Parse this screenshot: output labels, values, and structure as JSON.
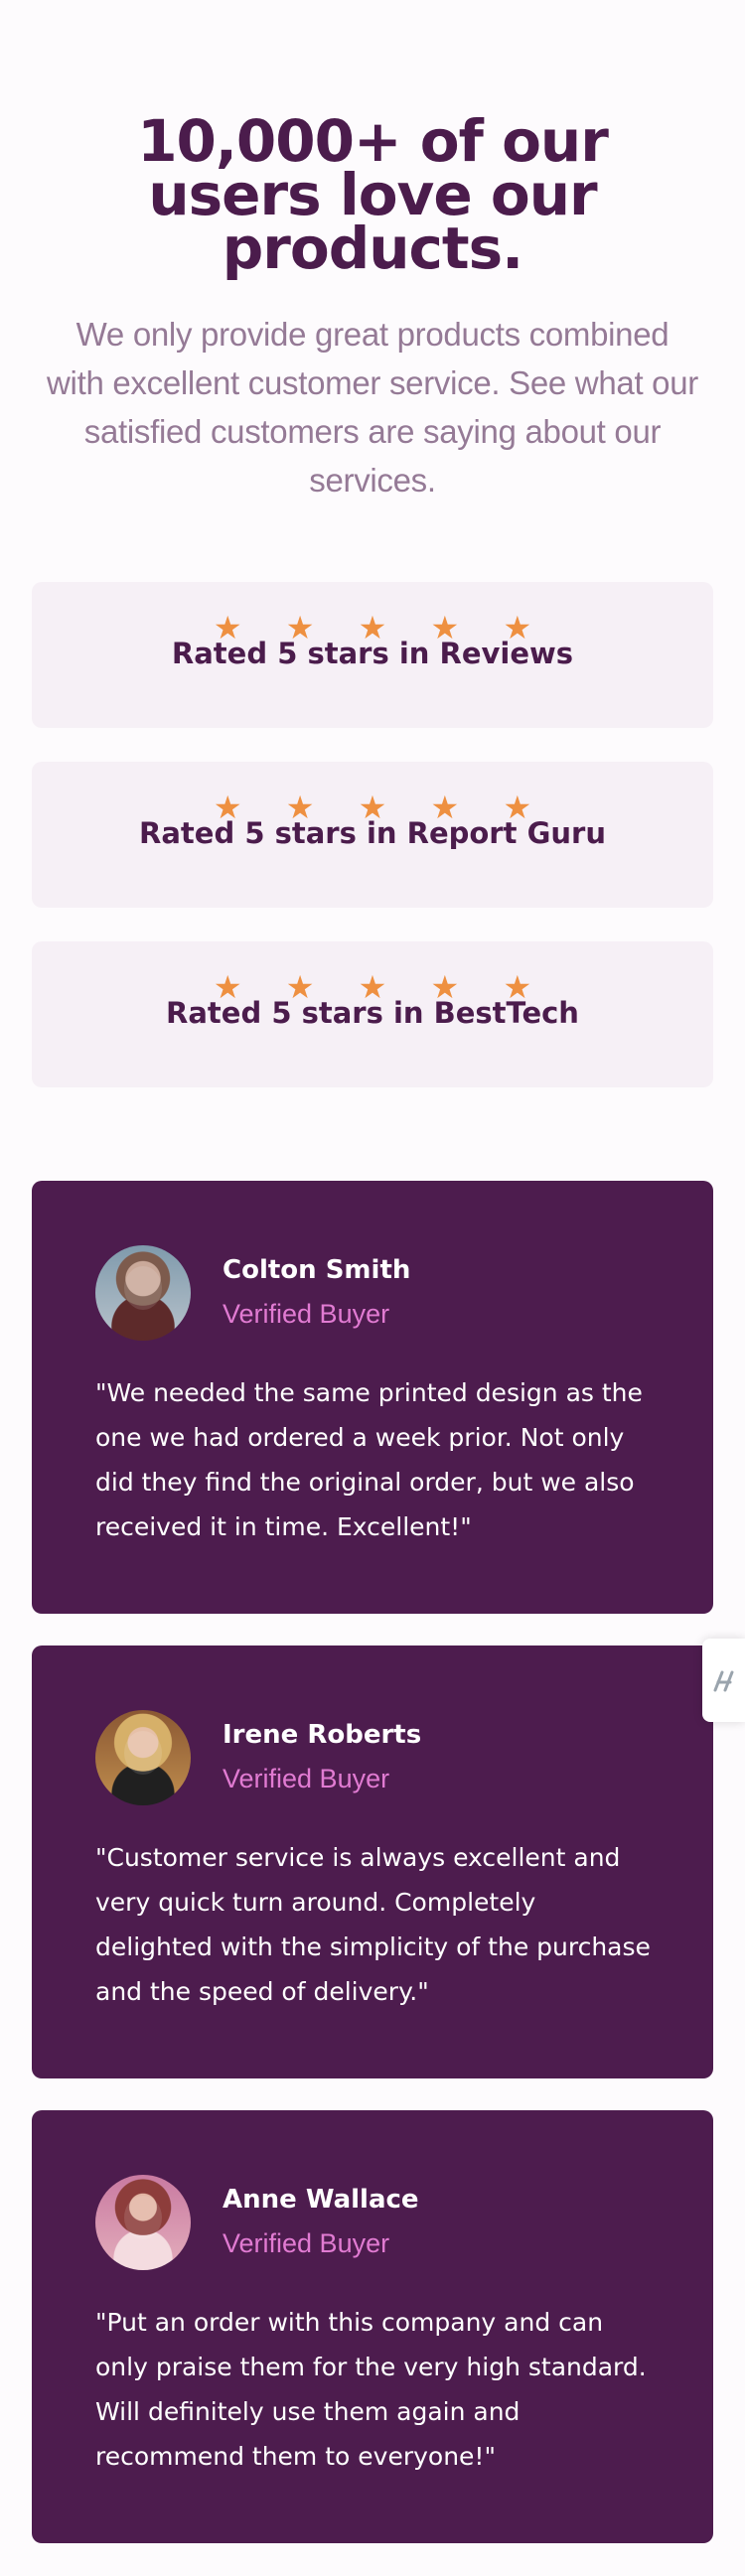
{
  "hero": {
    "title": "10,000+ of our users love our products.",
    "description": "We only provide great products combined with excellent customer service. See what our satisfied customers are saying about our services."
  },
  "ratings": [
    {
      "stars": [
        "★",
        "★",
        "★",
        "★",
        "★"
      ],
      "label": "Rated 5 stars in Reviews"
    },
    {
      "stars": [
        "★",
        "★",
        "★",
        "★",
        "★"
      ],
      "label": "Rated 5 stars in Report Guru"
    },
    {
      "stars": [
        "★",
        "★",
        "★",
        "★",
        "★"
      ],
      "label": "Rated 5 stars in BestTech"
    }
  ],
  "testimonials": [
    {
      "name": "Colton Smith",
      "badge": "Verified Buyer",
      "quote": "\"We needed the same printed design as the one we had ordered a week prior. Not only did they find the original order, but we also received it in time. Excellent!\""
    },
    {
      "name": "Irene Roberts",
      "badge": "Verified Buyer",
      "quote": "\"Customer service is always excellent and very quick turn around. Completely delighted with the simplicity of the purchase and the speed of delivery.\""
    },
    {
      "name": "Anne Wallace",
      "badge": "Verified Buyer",
      "quote": "\"Put an order with this company and can only praise them for the very high standard. Will definitely use them again and recommend them to everyone!\""
    }
  ],
  "colors": {
    "primary": "#4b1c4c",
    "accent_pink": "#e17bd2",
    "star_orange": "#ee9041",
    "soft_card": "#f6f0f6"
  },
  "icons": {
    "rating_icon": "star-icon",
    "side_widget_icon": "side-widget-icon"
  }
}
